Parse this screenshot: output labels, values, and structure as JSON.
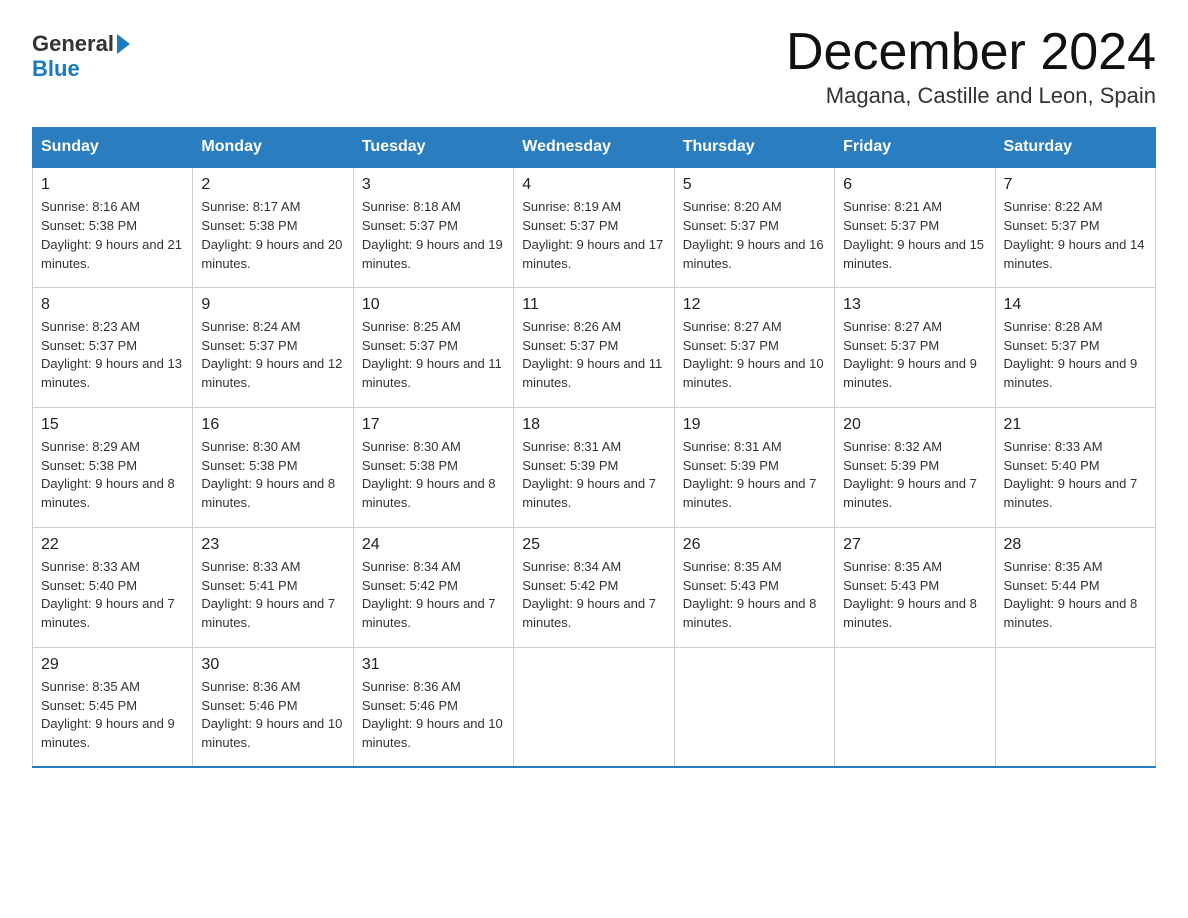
{
  "logo": {
    "general": "General",
    "arrow": "▶",
    "blue": "Blue"
  },
  "title": "December 2024",
  "subtitle": "Magana, Castille and Leon, Spain",
  "weekdays": [
    "Sunday",
    "Monday",
    "Tuesday",
    "Wednesday",
    "Thursday",
    "Friday",
    "Saturday"
  ],
  "weeks": [
    [
      {
        "day": "1",
        "sunrise": "8:16 AM",
        "sunset": "5:38 PM",
        "daylight": "9 hours and 21 minutes."
      },
      {
        "day": "2",
        "sunrise": "8:17 AM",
        "sunset": "5:38 PM",
        "daylight": "9 hours and 20 minutes."
      },
      {
        "day": "3",
        "sunrise": "8:18 AM",
        "sunset": "5:37 PM",
        "daylight": "9 hours and 19 minutes."
      },
      {
        "day": "4",
        "sunrise": "8:19 AM",
        "sunset": "5:37 PM",
        "daylight": "9 hours and 17 minutes."
      },
      {
        "day": "5",
        "sunrise": "8:20 AM",
        "sunset": "5:37 PM",
        "daylight": "9 hours and 16 minutes."
      },
      {
        "day": "6",
        "sunrise": "8:21 AM",
        "sunset": "5:37 PM",
        "daylight": "9 hours and 15 minutes."
      },
      {
        "day": "7",
        "sunrise": "8:22 AM",
        "sunset": "5:37 PM",
        "daylight": "9 hours and 14 minutes."
      }
    ],
    [
      {
        "day": "8",
        "sunrise": "8:23 AM",
        "sunset": "5:37 PM",
        "daylight": "9 hours and 13 minutes."
      },
      {
        "day": "9",
        "sunrise": "8:24 AM",
        "sunset": "5:37 PM",
        "daylight": "9 hours and 12 minutes."
      },
      {
        "day": "10",
        "sunrise": "8:25 AM",
        "sunset": "5:37 PM",
        "daylight": "9 hours and 11 minutes."
      },
      {
        "day": "11",
        "sunrise": "8:26 AM",
        "sunset": "5:37 PM",
        "daylight": "9 hours and 11 minutes."
      },
      {
        "day": "12",
        "sunrise": "8:27 AM",
        "sunset": "5:37 PM",
        "daylight": "9 hours and 10 minutes."
      },
      {
        "day": "13",
        "sunrise": "8:27 AM",
        "sunset": "5:37 PM",
        "daylight": "9 hours and 9 minutes."
      },
      {
        "day": "14",
        "sunrise": "8:28 AM",
        "sunset": "5:37 PM",
        "daylight": "9 hours and 9 minutes."
      }
    ],
    [
      {
        "day": "15",
        "sunrise": "8:29 AM",
        "sunset": "5:38 PM",
        "daylight": "9 hours and 8 minutes."
      },
      {
        "day": "16",
        "sunrise": "8:30 AM",
        "sunset": "5:38 PM",
        "daylight": "9 hours and 8 minutes."
      },
      {
        "day": "17",
        "sunrise": "8:30 AM",
        "sunset": "5:38 PM",
        "daylight": "9 hours and 8 minutes."
      },
      {
        "day": "18",
        "sunrise": "8:31 AM",
        "sunset": "5:39 PM",
        "daylight": "9 hours and 7 minutes."
      },
      {
        "day": "19",
        "sunrise": "8:31 AM",
        "sunset": "5:39 PM",
        "daylight": "9 hours and 7 minutes."
      },
      {
        "day": "20",
        "sunrise": "8:32 AM",
        "sunset": "5:39 PM",
        "daylight": "9 hours and 7 minutes."
      },
      {
        "day": "21",
        "sunrise": "8:33 AM",
        "sunset": "5:40 PM",
        "daylight": "9 hours and 7 minutes."
      }
    ],
    [
      {
        "day": "22",
        "sunrise": "8:33 AM",
        "sunset": "5:40 PM",
        "daylight": "9 hours and 7 minutes."
      },
      {
        "day": "23",
        "sunrise": "8:33 AM",
        "sunset": "5:41 PM",
        "daylight": "9 hours and 7 minutes."
      },
      {
        "day": "24",
        "sunrise": "8:34 AM",
        "sunset": "5:42 PM",
        "daylight": "9 hours and 7 minutes."
      },
      {
        "day": "25",
        "sunrise": "8:34 AM",
        "sunset": "5:42 PM",
        "daylight": "9 hours and 7 minutes."
      },
      {
        "day": "26",
        "sunrise": "8:35 AM",
        "sunset": "5:43 PM",
        "daylight": "9 hours and 8 minutes."
      },
      {
        "day": "27",
        "sunrise": "8:35 AM",
        "sunset": "5:43 PM",
        "daylight": "9 hours and 8 minutes."
      },
      {
        "day": "28",
        "sunrise": "8:35 AM",
        "sunset": "5:44 PM",
        "daylight": "9 hours and 8 minutes."
      }
    ],
    [
      {
        "day": "29",
        "sunrise": "8:35 AM",
        "sunset": "5:45 PM",
        "daylight": "9 hours and 9 minutes."
      },
      {
        "day": "30",
        "sunrise": "8:36 AM",
        "sunset": "5:46 PM",
        "daylight": "9 hours and 10 minutes."
      },
      {
        "day": "31",
        "sunrise": "8:36 AM",
        "sunset": "5:46 PM",
        "daylight": "9 hours and 10 minutes."
      },
      null,
      null,
      null,
      null
    ]
  ]
}
